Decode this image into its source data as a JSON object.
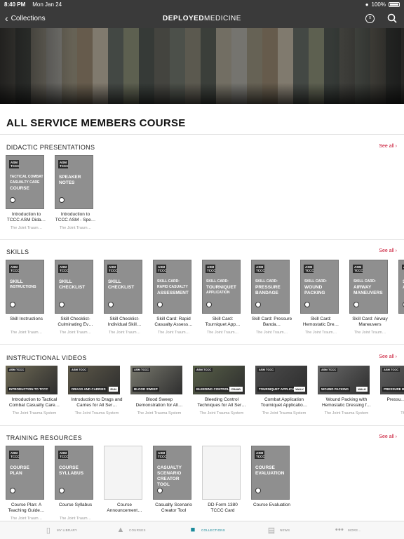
{
  "status_bar": {
    "time": "8:40 PM",
    "date": "Mon Jan 24",
    "battery": "100%"
  },
  "nav": {
    "back_label": "Collections",
    "logo_bold": "DEPLOYED",
    "logo_light": "MEDICINE",
    "filter_icon": "filter-icon",
    "search_icon": "search-icon"
  },
  "page_title": "ALL SERVICE MEMBERS COURSE",
  "see_all": "See all",
  "sections": [
    {
      "title": "DIDACTIC PRESENTATIONS",
      "items": [
        {
          "title": "Introduction to TCCC ASM Dida…",
          "sub": "The Joint Traum…",
          "cover": [
            "TACTICAL COMBAT",
            "CASUALTY CARE",
            "COURSE"
          ],
          "tag": "ASM TCCC"
        },
        {
          "title": "Introduction to TCCC ASM - Spe…",
          "sub": "The Joint Traum…",
          "cover": [
            "SPEAKER",
            "NOTES"
          ],
          "tag": "ASM TCCC"
        }
      ]
    },
    {
      "title": "SKILLS",
      "items": [
        {
          "title": "Skill Instructions",
          "sub": "The Joint Traum…",
          "cover": [
            "SKILL",
            "INSTRUCTIONS"
          ],
          "tag": "ASM TCCC"
        },
        {
          "title": "Skill Checklist-Culminating Ev…",
          "sub": "The Joint Traum…",
          "cover": [
            "SKILL",
            "CHECKLIST"
          ],
          "tag": "ASM TCCC"
        },
        {
          "title": "Skill Checklist-Individual Skill…",
          "sub": "The Joint Traum…",
          "cover": [
            "SKILL",
            "CHECKLIST"
          ],
          "tag": "ASM TCCC"
        },
        {
          "title": "Skill Card: Rapid Casualty Assess…",
          "sub": "The Joint Traum…",
          "cover": [
            "SKILL CARD:",
            "RAPID CASUALTY",
            "ASSESSMENT"
          ],
          "tag": "ASM TCCC"
        },
        {
          "title": "Skill Card: Tourniquet App…",
          "sub": "The Joint Traum…",
          "cover": [
            "SKILL CARD:",
            "TOURNIQUET",
            "APPLICATION"
          ],
          "tag": "ASM TCCC"
        },
        {
          "title": "Skill Card: Pressure Banda…",
          "sub": "The Joint Traum…",
          "cover": [
            "SKILL CARD:",
            "PRESSURE",
            "BANDAGE"
          ],
          "tag": "ASM TCCC"
        },
        {
          "title": "Skill Card: Hemostatic Dre…",
          "sub": "The Joint Traum…",
          "cover": [
            "SKILL CARD:",
            "WOUND",
            "PACKING"
          ],
          "tag": "ASM TCCC"
        },
        {
          "title": "Skill Card: Airway Maneuvers",
          "sub": "The Joint Traum…",
          "cover": [
            "SKILL CARD:",
            "AIRWAY",
            "MANEUVERS"
          ],
          "tag": "ASM TCCC"
        },
        {
          "title": "Ski…",
          "sub": "The…",
          "cover": [
            "SK…",
            "AI…"
          ],
          "tag": "ASM"
        }
      ]
    },
    {
      "title": "INSTRUCTIONAL VIDEOS",
      "items": [
        {
          "title": "Introduction to Tactical Combat Casualty Care…",
          "sub": "The Joint Trauma System",
          "label": "INTRODUCTION TO TCCC",
          "dur": ""
        },
        {
          "title": "Introduction to Drags and Carries for All Ser…",
          "sub": "The Joint Trauma System",
          "label": "DRAGS AND CARRIES",
          "dur": "RUN"
        },
        {
          "title": "Blood Sweep Demonstration for All…",
          "sub": "The Joint Trauma System",
          "label": "BLOOD SWEEP",
          "dur": ""
        },
        {
          "title": "Bleeding Control Techniques for All Ser…",
          "sub": "The Joint Trauma System",
          "label": "BLEEDING CONTROL",
          "dur": "CRAWL"
        },
        {
          "title": "Combat Application Tourniquet Applicatio…",
          "sub": "The Joint Trauma System",
          "label": "TOURNIQUET APPLICATION",
          "dur": "WALK"
        },
        {
          "title": "Wound Packing with Hemostatic Dressing f…",
          "sub": "The Joint Trauma System",
          "label": "WOUND PACKING",
          "dur": "WALK"
        },
        {
          "title": "Pressu… Applicatio…",
          "sub": "The Joi…",
          "label": "PRESSURE BANDAGE",
          "dur": ""
        }
      ]
    },
    {
      "title": "TRAINING RESOURCES",
      "items": [
        {
          "title": "Course Plan: A Teaching Guide…",
          "sub": "The Joint Traum…",
          "cover": [
            "COURSE",
            "PLAN"
          ],
          "tag": "ASM TCCC"
        },
        {
          "title": "Course Syllabus",
          "sub": "The Joint Traum…",
          "cover": [
            "COURSE",
            "SYLLABUS"
          ],
          "tag": "ASM TCCC"
        },
        {
          "title": "Course Announcement…",
          "sub": "",
          "cover": [],
          "tag": ""
        },
        {
          "title": "Casualty Scenario Creator Tool",
          "sub": "",
          "cover": [
            "CASUALTY",
            "SCENARIO",
            "CREATOR",
            "TOOL"
          ],
          "tag": "ASM TCCC"
        },
        {
          "title": "DD Form 1380 TCCC Card",
          "sub": "",
          "cover": [],
          "tag": ""
        },
        {
          "title": "Course Evaluation",
          "sub": "",
          "cover": [
            "COURSE",
            "EVALUATION"
          ],
          "tag": "ASM TCCC"
        }
      ]
    }
  ],
  "tabs": [
    {
      "label": "MY LIBRARY",
      "icon": "bookmark-icon",
      "active": false
    },
    {
      "label": "COURSES",
      "icon": "graduation-cap-icon",
      "active": false
    },
    {
      "label": "COLLECTIONS",
      "icon": "folder-icon",
      "active": true
    },
    {
      "label": "NEWS",
      "icon": "newspaper-icon",
      "active": false
    },
    {
      "label": "MORE...",
      "icon": "more-icon",
      "active": false
    }
  ]
}
